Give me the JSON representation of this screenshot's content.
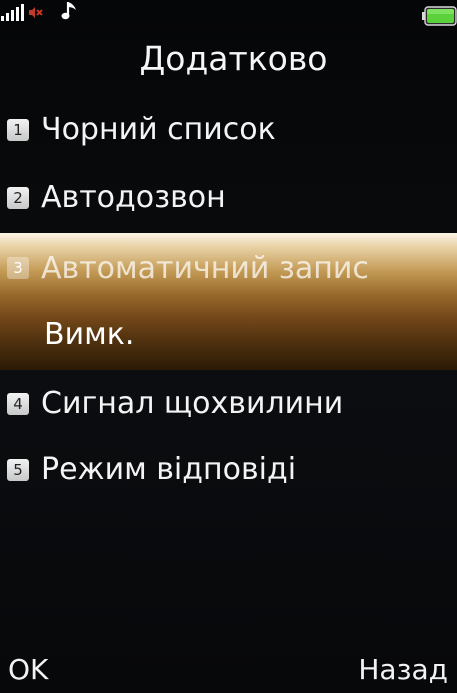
{
  "statusbar": {
    "icons": [
      "signal-icon",
      "silent-mode-icon",
      "music-note-icon",
      "battery-icon"
    ],
    "battery_color": "#5bd13c"
  },
  "screen": {
    "title": "Додатково"
  },
  "menu": {
    "items": [
      {
        "number": "1",
        "label": "Чорний список"
      },
      {
        "number": "2",
        "label": "Автодозвон"
      },
      {
        "number": "3",
        "label": "Автоматичний запис",
        "value": "Вимк.",
        "selected": true
      },
      {
        "number": "4",
        "label": "Сигнал щохвилини"
      },
      {
        "number": "5",
        "label": "Режим відповіді"
      }
    ]
  },
  "softkeys": {
    "left": "OK",
    "right": "Назад"
  },
  "colors": {
    "highlight_top": "#fbf4e6",
    "highlight_bottom": "#2a1906",
    "badge": "#e0e0e0"
  }
}
